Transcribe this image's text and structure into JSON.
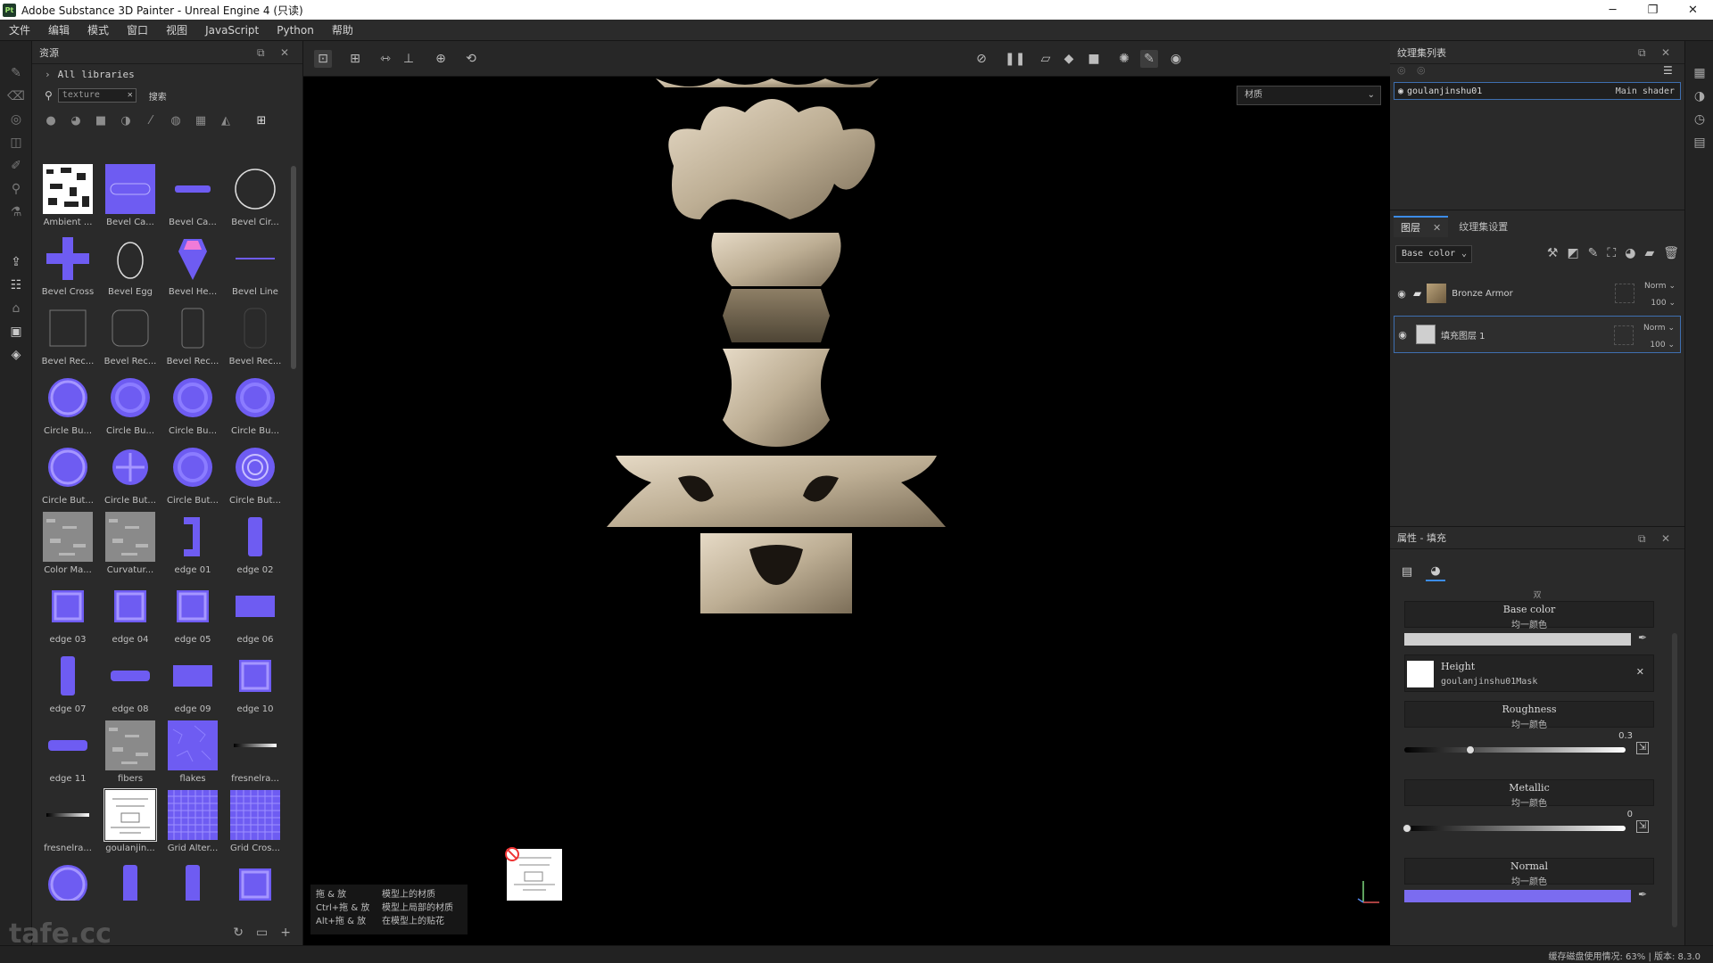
{
  "window": {
    "title": "Adobe Substance 3D Painter - Unreal Engine 4 (只读)",
    "app_badge": "Pt"
  },
  "menu": [
    "文件",
    "编辑",
    "模式",
    "窗口",
    "视图",
    "JavaScript",
    "Python",
    "帮助"
  ],
  "assets": {
    "title": "资源",
    "library_path": "All libraries",
    "search_value": "texture",
    "search_label": "搜索",
    "items": [
      {
        "label": "Ambient ...",
        "kind": "noise"
      },
      {
        "label": "Bevel Ca...",
        "kind": "bevel-square"
      },
      {
        "label": "Bevel Ca...",
        "kind": "bevel-bar"
      },
      {
        "label": "Bevel Cir...",
        "kind": "circle-outline"
      },
      {
        "label": "Bevel Cross",
        "kind": "cross"
      },
      {
        "label": "Bevel Egg",
        "kind": "egg"
      },
      {
        "label": "Bevel He...",
        "kind": "hex"
      },
      {
        "label": "Bevel Line",
        "kind": "line"
      },
      {
        "label": "Bevel Rec...",
        "kind": "rect-outline"
      },
      {
        "label": "Bevel Rec...",
        "kind": "rect-round"
      },
      {
        "label": "Bevel Rec...",
        "kind": "rect-tall"
      },
      {
        "label": "Bevel Rec...",
        "kind": "rect-faint"
      },
      {
        "label": "Circle Bu...",
        "kind": "circle-fill"
      },
      {
        "label": "Circle Bu...",
        "kind": "circle-ring"
      },
      {
        "label": "Circle Bu...",
        "kind": "circle-ring"
      },
      {
        "label": "Circle Bu...",
        "kind": "circle-ring"
      },
      {
        "label": "Circle But...",
        "kind": "circle-fill"
      },
      {
        "label": "Circle But...",
        "kind": "circle-cross"
      },
      {
        "label": "Circle But...",
        "kind": "circle-ring"
      },
      {
        "label": "Circle But...",
        "kind": "circle-double"
      },
      {
        "label": "Color Ma...",
        "kind": "gray-noise"
      },
      {
        "label": "Curvatur...",
        "kind": "gray-noise"
      },
      {
        "label": "edge 01",
        "kind": "edge-hook"
      },
      {
        "label": "edge 02",
        "kind": "edge-tall"
      },
      {
        "label": "edge 03",
        "kind": "edge-box"
      },
      {
        "label": "edge 04",
        "kind": "edge-box"
      },
      {
        "label": "edge 05",
        "kind": "edge-box"
      },
      {
        "label": "edge 06",
        "kind": "edge-wide"
      },
      {
        "label": "edge 07",
        "kind": "edge-tall"
      },
      {
        "label": "edge 08",
        "kind": "edge-bar"
      },
      {
        "label": "edge 09",
        "kind": "edge-wide"
      },
      {
        "label": "edge 10",
        "kind": "edge-box"
      },
      {
        "label": "edge 11",
        "kind": "edge-bar"
      },
      {
        "label": "fibers",
        "kind": "gray-noise"
      },
      {
        "label": "flakes",
        "kind": "flakes"
      },
      {
        "label": "fresnelra...",
        "kind": "fresnel"
      },
      {
        "label": "fresnelra...",
        "kind": "fresnel"
      },
      {
        "label": "goulanjin...",
        "kind": "mask"
      },
      {
        "label": "Grid Alter...",
        "kind": "grid"
      },
      {
        "label": "Grid Cros...",
        "kind": "grid"
      },
      {
        "label": "",
        "kind": "circle-fill"
      },
      {
        "label": "",
        "kind": "edge-tall"
      },
      {
        "label": "",
        "kind": "edge-tall"
      },
      {
        "label": "",
        "kind": "edge-box"
      }
    ]
  },
  "viewport": {
    "material_select": "材质",
    "hint": [
      {
        "keys": "拖 & 放",
        "desc": "模型上的材质"
      },
      {
        "keys": "Ctrl+拖 & 放",
        "desc": "模型上局部的材质"
      },
      {
        "keys": "Alt+拖 & 放",
        "desc": "在模型上的贴花"
      }
    ]
  },
  "texture_sets": {
    "title": "纹理集列表",
    "set_name": "goulanjinshu01",
    "shader": "Main shader"
  },
  "layers": {
    "tab_layers": "图层",
    "tab_settings": "纹理集设置",
    "channel": "Base color",
    "items": [
      {
        "name": "Bronze Armor",
        "blend": "Norm",
        "opacity": "100"
      },
      {
        "name": "填充图层 1",
        "blend": "Norm",
        "opacity": "100"
      }
    ]
  },
  "properties": {
    "title": "属性 - 填充",
    "section": "双",
    "base_color": {
      "name": "Base color",
      "sub": "均一颜色",
      "color": "#cfcfcf"
    },
    "height": {
      "name": "Height",
      "sub": "goulanjinshu01Mask"
    },
    "roughness": {
      "name": "Roughness",
      "sub": "均一颜色",
      "value": "0.3",
      "fraction": 0.3
    },
    "metallic": {
      "name": "Metallic",
      "sub": "均一颜色",
      "value": "0",
      "fraction": 0
    },
    "normal": {
      "name": "Normal",
      "sub": "均一颜色",
      "color": "#7b6cf0"
    }
  },
  "status": {
    "text": "缓存磁盘使用情况:  63%  |  版本:  8.3.0"
  },
  "watermark": "tafe.cc",
  "colors": {
    "accent": "#3c8ce7",
    "purple": "#6e5cf2",
    "selection": "#3e6fb0"
  }
}
